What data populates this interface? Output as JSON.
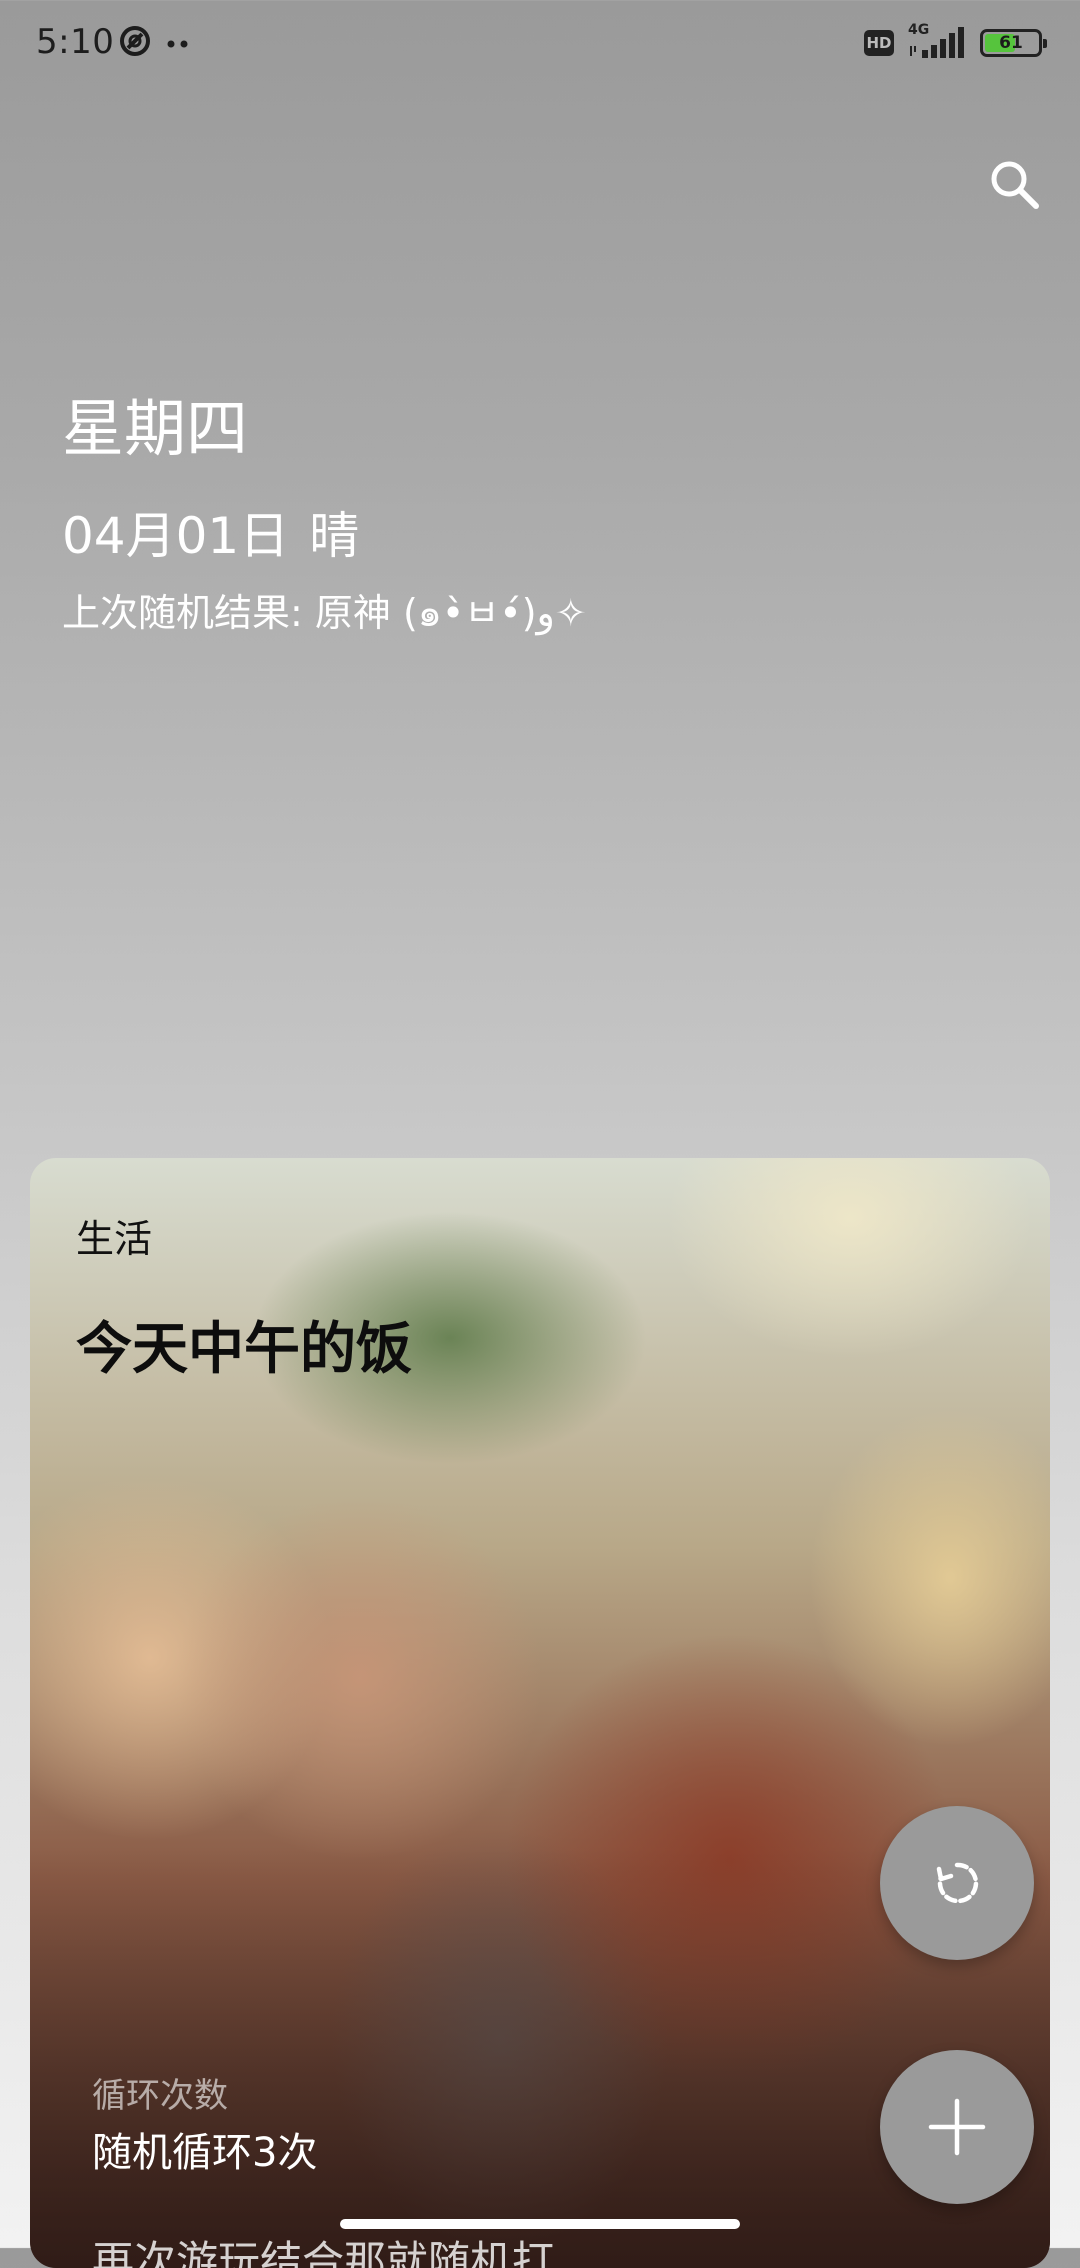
{
  "status_bar": {
    "time": "5:10",
    "network": "4G",
    "hd_label": "HD",
    "battery_level": "61",
    "battery_fraction": 0.61,
    "left_icons": [
      "app-notification-icon",
      "more-dots-icon"
    ],
    "battery_color": "#56c43d"
  },
  "header": {
    "weekday": "星期四",
    "date": "04月01日",
    "weather": "晴",
    "last_result": "上次随机结果: 原神 (๑•̀ㅂ•́)و✧"
  },
  "card": {
    "category": "生活",
    "title": "今天中午的饭",
    "loop_label": "循环次数",
    "loop_value": "随机循环3次",
    "next_text": "再次游玩结合那就随机打"
  },
  "actions": {
    "search_icon": "search-icon",
    "refresh_icon": "refresh-icon",
    "add_icon": "plus-icon"
  }
}
